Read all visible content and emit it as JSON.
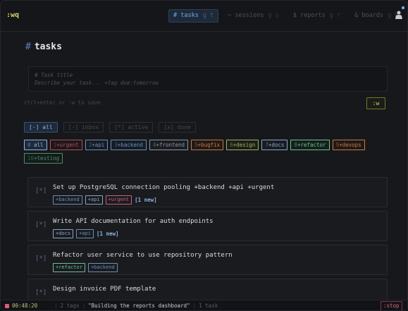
{
  "app": {
    "brand": ":wq"
  },
  "nav": {
    "tabs": [
      {
        "label": "# tasks",
        "key": "g t",
        "active": true
      },
      {
        "label": "~ sessions",
        "key": "g s",
        "active": false
      },
      {
        "label": "$ reports",
        "key": "g r",
        "active": false
      },
      {
        "label": "& boards",
        "key": "g b",
        "active": false
      }
    ]
  },
  "page": {
    "title_prefix": "#",
    "title": "tasks"
  },
  "composer": {
    "placeholder_title": "# Task title",
    "placeholder_desc": "Describe your task... +tag due:tomorrow"
  },
  "hint": "ctrl+enter or :w to save",
  "save_label": ":w",
  "filters": [
    {
      "label": "[-] all",
      "active": true
    },
    {
      "label": "[-] inbox",
      "active": false
    },
    {
      "label": "[*] active",
      "active": false
    },
    {
      "label": "[x] done",
      "active": false
    }
  ],
  "tags": [
    {
      "num": "0",
      "label": "all",
      "color": "#8fb3e3",
      "bg": "#1e2a3a"
    },
    {
      "num": "1",
      "label": "+urgent",
      "color": "#a8515f",
      "bg": "#1f1719"
    },
    {
      "num": "2",
      "label": "+api",
      "color": "#6c8fb5",
      "bg": "#161c24"
    },
    {
      "num": "3",
      "label": "+backend",
      "color": "#6c8fb5",
      "bg": "#161c24"
    },
    {
      "num": "4",
      "label": "+frontend",
      "color": "#8d94a2",
      "bg": "#1a1c20"
    },
    {
      "num": "5",
      "label": "+bugfix",
      "color": "#c0794f",
      "bg": "#221a15"
    },
    {
      "num": "6",
      "label": "+design",
      "color": "#9fb070",
      "bg": "#1b1f16"
    },
    {
      "num": "7",
      "label": "+docs",
      "color": "#8aa5c7",
      "bg": "#181c22"
    },
    {
      "num": "8",
      "label": "+refactor",
      "color": "#6dbd9a",
      "bg": "#152019"
    },
    {
      "num": "9",
      "label": "+devops",
      "color": "#c27b4d",
      "bg": "#211914"
    },
    {
      "num": "10",
      "label": "+testing",
      "color": "#4e8a72",
      "bg": "#141c18"
    }
  ],
  "tasks": [
    {
      "status": "[*]",
      "title": "Set up PostgreSQL connection pooling +backend +api +urgent",
      "chips": [
        {
          "label": "+backend",
          "color": "#6c8fb5"
        },
        {
          "label": "+api",
          "color": "#8aa5c7"
        },
        {
          "label": "+urgent",
          "color": "#c9617a"
        }
      ],
      "badge": "[1 new]"
    },
    {
      "status": "[*]",
      "title": "Write API documentation for auth endpoints",
      "chips": [
        {
          "label": "+docs",
          "color": "#8aa5c7"
        },
        {
          "label": "+api",
          "color": "#6c8fb5"
        }
      ],
      "badge": "[1 new]"
    },
    {
      "status": "[*]",
      "title": "Refactor user service to use repository pattern",
      "chips": [
        {
          "label": "+refactor",
          "color": "#6dbd9a"
        },
        {
          "label": "+backend",
          "color": "#6c8fb5"
        }
      ],
      "badge": ""
    },
    {
      "status": "[*]",
      "title": "Design invoice PDF template",
      "chips": [],
      "badge": ""
    }
  ],
  "statusbar": {
    "timer": "00:48:20",
    "tags_count": "2 tags",
    "description": "\"Building the reports dashboard\"",
    "task_count": "1 task",
    "stop_label": ":stop"
  },
  "icons": {
    "user": "user-icon",
    "recording": "recording-icon"
  }
}
